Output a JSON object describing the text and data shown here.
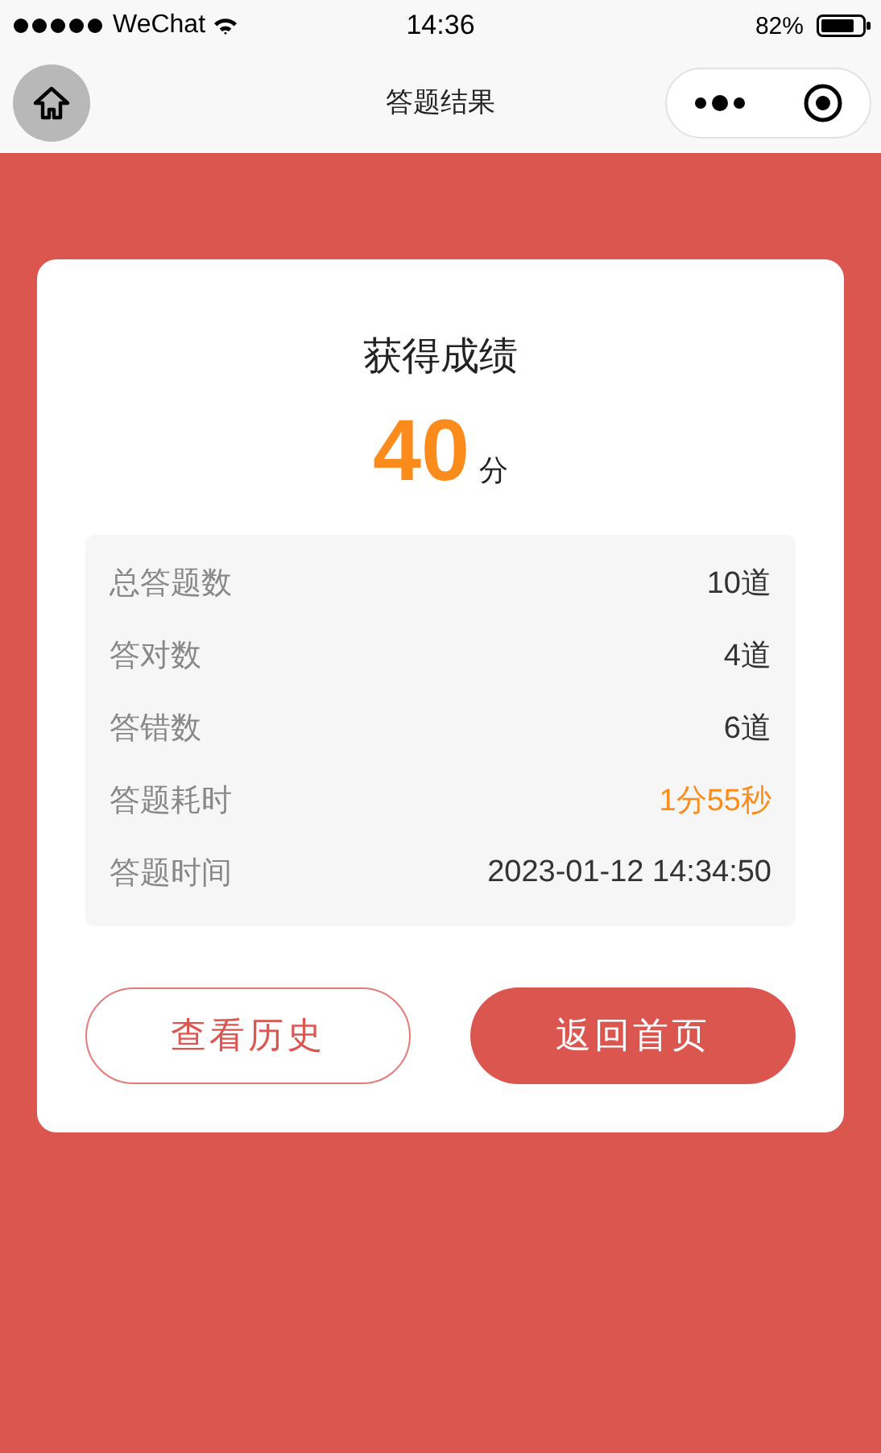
{
  "status_bar": {
    "carrier": "WeChat",
    "time": "14:36",
    "battery": "82%"
  },
  "nav": {
    "title": "答题结果"
  },
  "result": {
    "title": "获得成绩",
    "score": "40",
    "unit": "分"
  },
  "stats": [
    {
      "label": "总答题数",
      "value": "10道",
      "highlight": false
    },
    {
      "label": "答对数",
      "value": "4道",
      "highlight": false
    },
    {
      "label": "答错数",
      "value": "6道",
      "highlight": false
    },
    {
      "label": "答题耗时",
      "value": "1分55秒",
      "highlight": true
    },
    {
      "label": "答题时间",
      "value": "2023-01-12 14:34:50",
      "highlight": false
    }
  ],
  "buttons": [
    {
      "label": "查看历史",
      "kind": "outline"
    },
    {
      "label": "返回首页",
      "kind": "filled"
    }
  ]
}
